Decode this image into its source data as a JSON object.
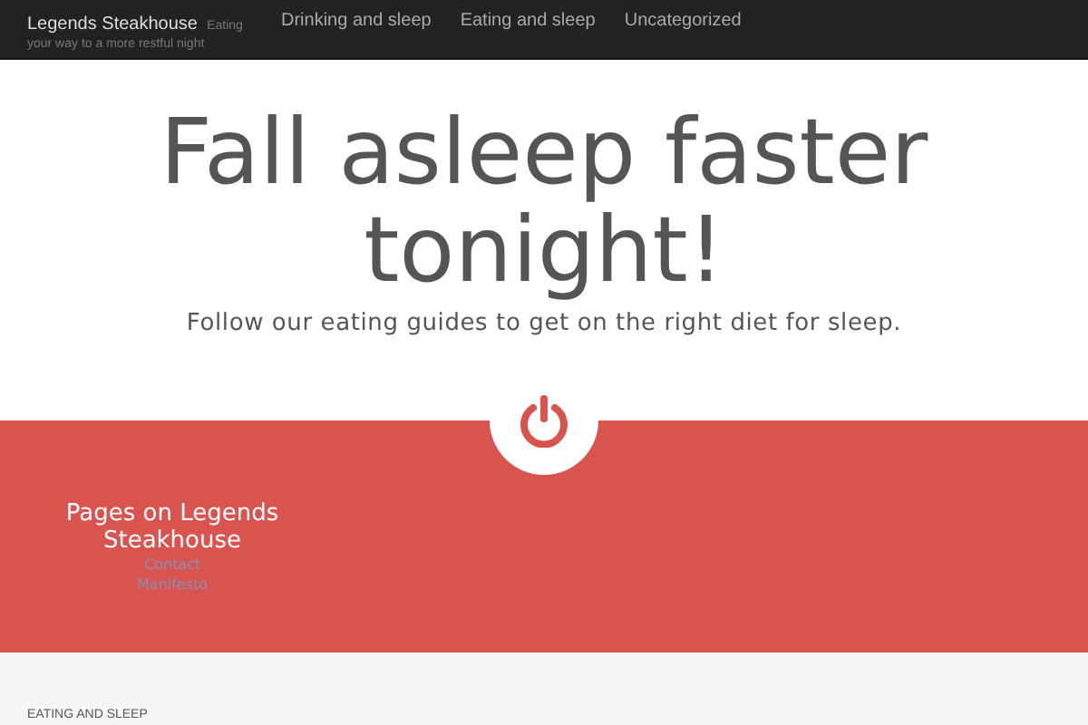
{
  "nav": {
    "brand": "Legends Steakhouse",
    "tagline_start": "Eating",
    "tagline_rest": "your way to a more restful night",
    "items": [
      {
        "label": "Drinking and sleep"
      },
      {
        "label": "Eating and sleep"
      },
      {
        "label": "Uncategorized"
      }
    ]
  },
  "hero": {
    "title": "Fall asleep faster tonight!",
    "subtitle": "Follow our eating guides to get on the right diet for sleep."
  },
  "pages": {
    "title": "Pages on Legends Steakhouse",
    "links": [
      "Contact",
      "Manifesto"
    ]
  },
  "section_heading": "EATING AND SLEEP"
}
